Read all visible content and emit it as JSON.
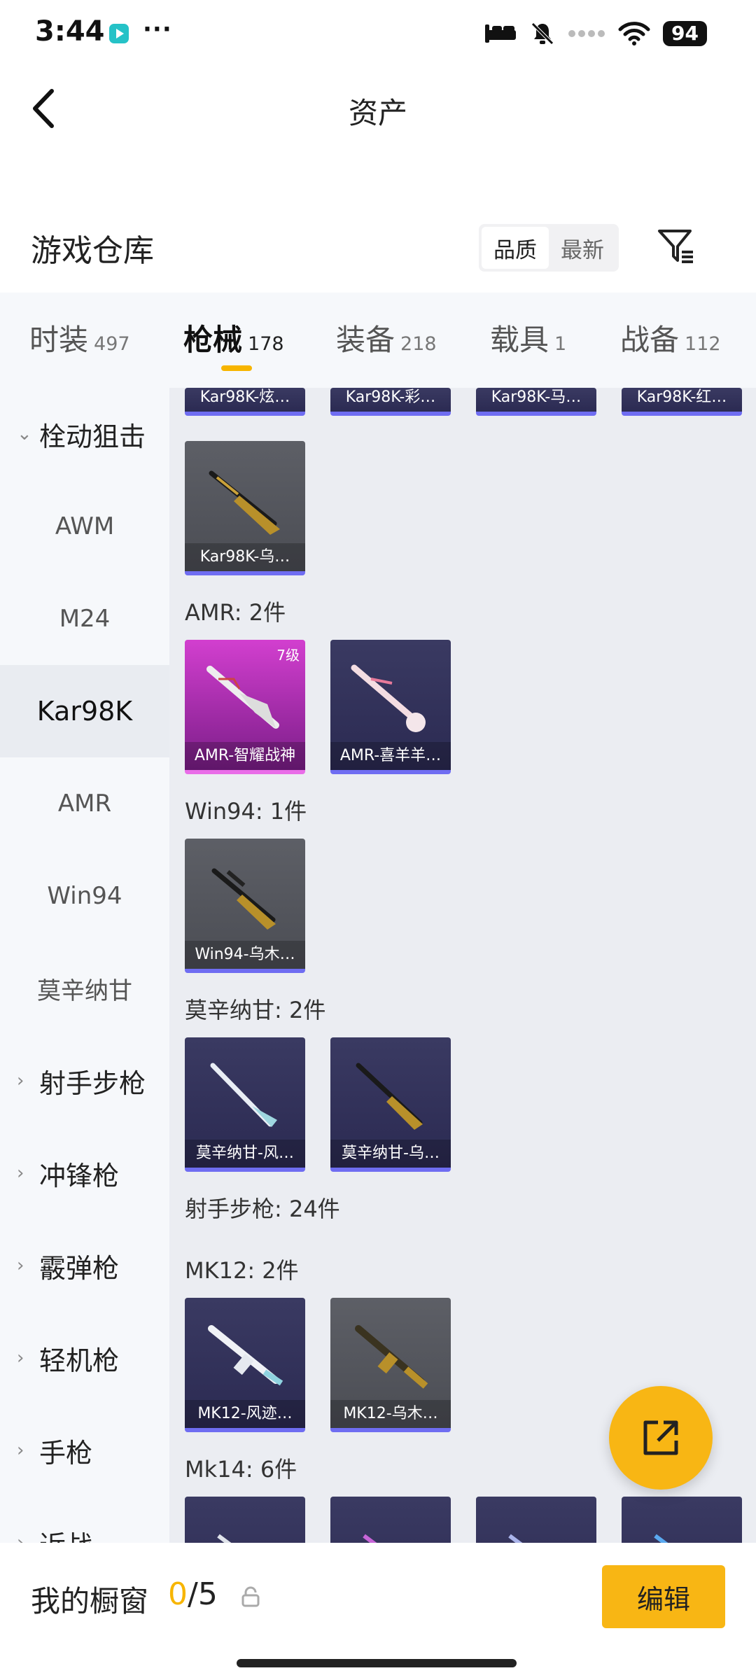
{
  "status": {
    "time": "3:44",
    "battery": "94",
    "more": "···"
  },
  "header": {
    "title": "资产",
    "back_icon": "chevron-left-icon"
  },
  "repo": {
    "title": "游戏仓库",
    "sort": {
      "options": [
        "品质",
        "最新"
      ],
      "selected": "品质"
    },
    "filter_icon": "filter-icon"
  },
  "tabs": [
    {
      "label": "时装",
      "count": "497"
    },
    {
      "label": "枪械",
      "count": "178",
      "active": true
    },
    {
      "label": "装备",
      "count": "218"
    },
    {
      "label": "载具",
      "count": "1"
    },
    {
      "label": "战备",
      "count": "112"
    }
  ],
  "sidebar": [
    {
      "label": "栓动狙击",
      "type": "group",
      "expanded": true
    },
    {
      "label": "AWM",
      "type": "sub"
    },
    {
      "label": "M24",
      "type": "sub"
    },
    {
      "label": "Kar98K",
      "type": "sub",
      "active": true
    },
    {
      "label": "AMR",
      "type": "sub"
    },
    {
      "label": "Win94",
      "type": "sub"
    },
    {
      "label": "莫辛纳甘",
      "type": "sub"
    },
    {
      "label": "射手步枪",
      "type": "group"
    },
    {
      "label": "冲锋枪",
      "type": "group"
    },
    {
      "label": "霰弹枪",
      "type": "group"
    },
    {
      "label": "轻机枪",
      "type": "group"
    },
    {
      "label": "手枪",
      "type": "group"
    },
    {
      "label": "近战",
      "type": "group"
    }
  ],
  "grid": {
    "top_row": [
      "Kar98K-炫…",
      "Kar98K-彩…",
      "Kar98K-马…",
      "Kar98K-红…"
    ],
    "kar_extra": "Kar98K-乌…",
    "sections": {
      "amr": "AMR: 2件",
      "win94": "Win94: 1件",
      "mosin": "莫辛纳甘: 2件",
      "dmr": "射手步枪: 24件",
      "mk12": "MK12: 2件",
      "mk14": "Mk14: 6件"
    },
    "amr_items": [
      {
        "name": "AMR-智耀战神",
        "level": "7级"
      },
      {
        "name": "AMR-喜羊羊…"
      }
    ],
    "win94_items": [
      {
        "name": "Win94-乌木…"
      }
    ],
    "mosin_items": [
      {
        "name": "莫辛纳甘-风…"
      },
      {
        "name": "莫辛纳甘-乌…"
      }
    ],
    "mk12_items": [
      {
        "name": "MK12-风迹…"
      },
      {
        "name": "MK12-乌木…"
      }
    ]
  },
  "fab_icon": "share-external-icon",
  "bottom": {
    "label": "我的橱窗",
    "current": "0",
    "total": "/5",
    "lock_icon": "lock-icon",
    "edit": "编辑"
  },
  "colors": {
    "accent": "#f8b614",
    "rare_purple": "#6f6df2",
    "legend_pink": "#d23fcf"
  }
}
